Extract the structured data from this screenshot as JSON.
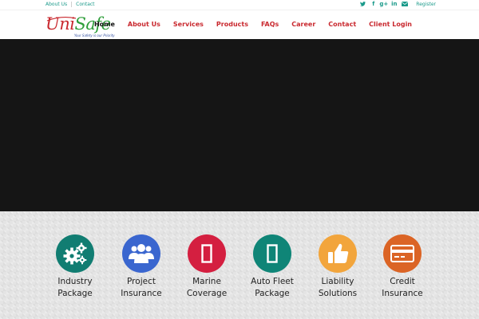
{
  "top_links": {
    "about": "About Us",
    "contact": "Contact"
  },
  "top_right": {
    "register": "Register",
    "social_icons": [
      "twitter-icon",
      "facebook-icon",
      "google-plus-icon",
      "linkedin-icon",
      "envelope-icon"
    ],
    "facebook_glyph": "f",
    "gplus_glyph": "g+",
    "linkedin_glyph": "in"
  },
  "logo": {
    "text_part1": "Uni",
    "text_part2": "Safe",
    "tagline": "Your Safety is our Priority"
  },
  "nav": {
    "items": [
      "Home",
      "About Us",
      "Services",
      "Products",
      "FAQs",
      "Career",
      "Contact",
      "Client Login"
    ],
    "active": "Home"
  },
  "colors": {
    "brand_red": "#c9282e",
    "brand_green": "#2e9e3a",
    "accent_teal": "#1a9a8a",
    "hero_bg": "#151515"
  },
  "services": [
    {
      "line1": "Industry",
      "line2": "Package",
      "color": "#117d72",
      "icon": "gears-icon"
    },
    {
      "line1": "Project",
      "line2": "Insurance",
      "color": "#3a66cf",
      "icon": "users-icon"
    },
    {
      "line1": "Marine",
      "line2": "Coverage",
      "color": "#d41f40",
      "icon": "ship-icon"
    },
    {
      "line1": "Auto Fleet",
      "line2": "Package",
      "color": "#0f8577",
      "icon": "car-icon"
    },
    {
      "line1": "Liability",
      "line2": "Solutions",
      "color": "#f2a53c",
      "icon": "thumbs-up-icon"
    },
    {
      "line1": "Credit",
      "line2": "Insurance",
      "color": "#db6425",
      "icon": "credit-card-icon"
    }
  ]
}
